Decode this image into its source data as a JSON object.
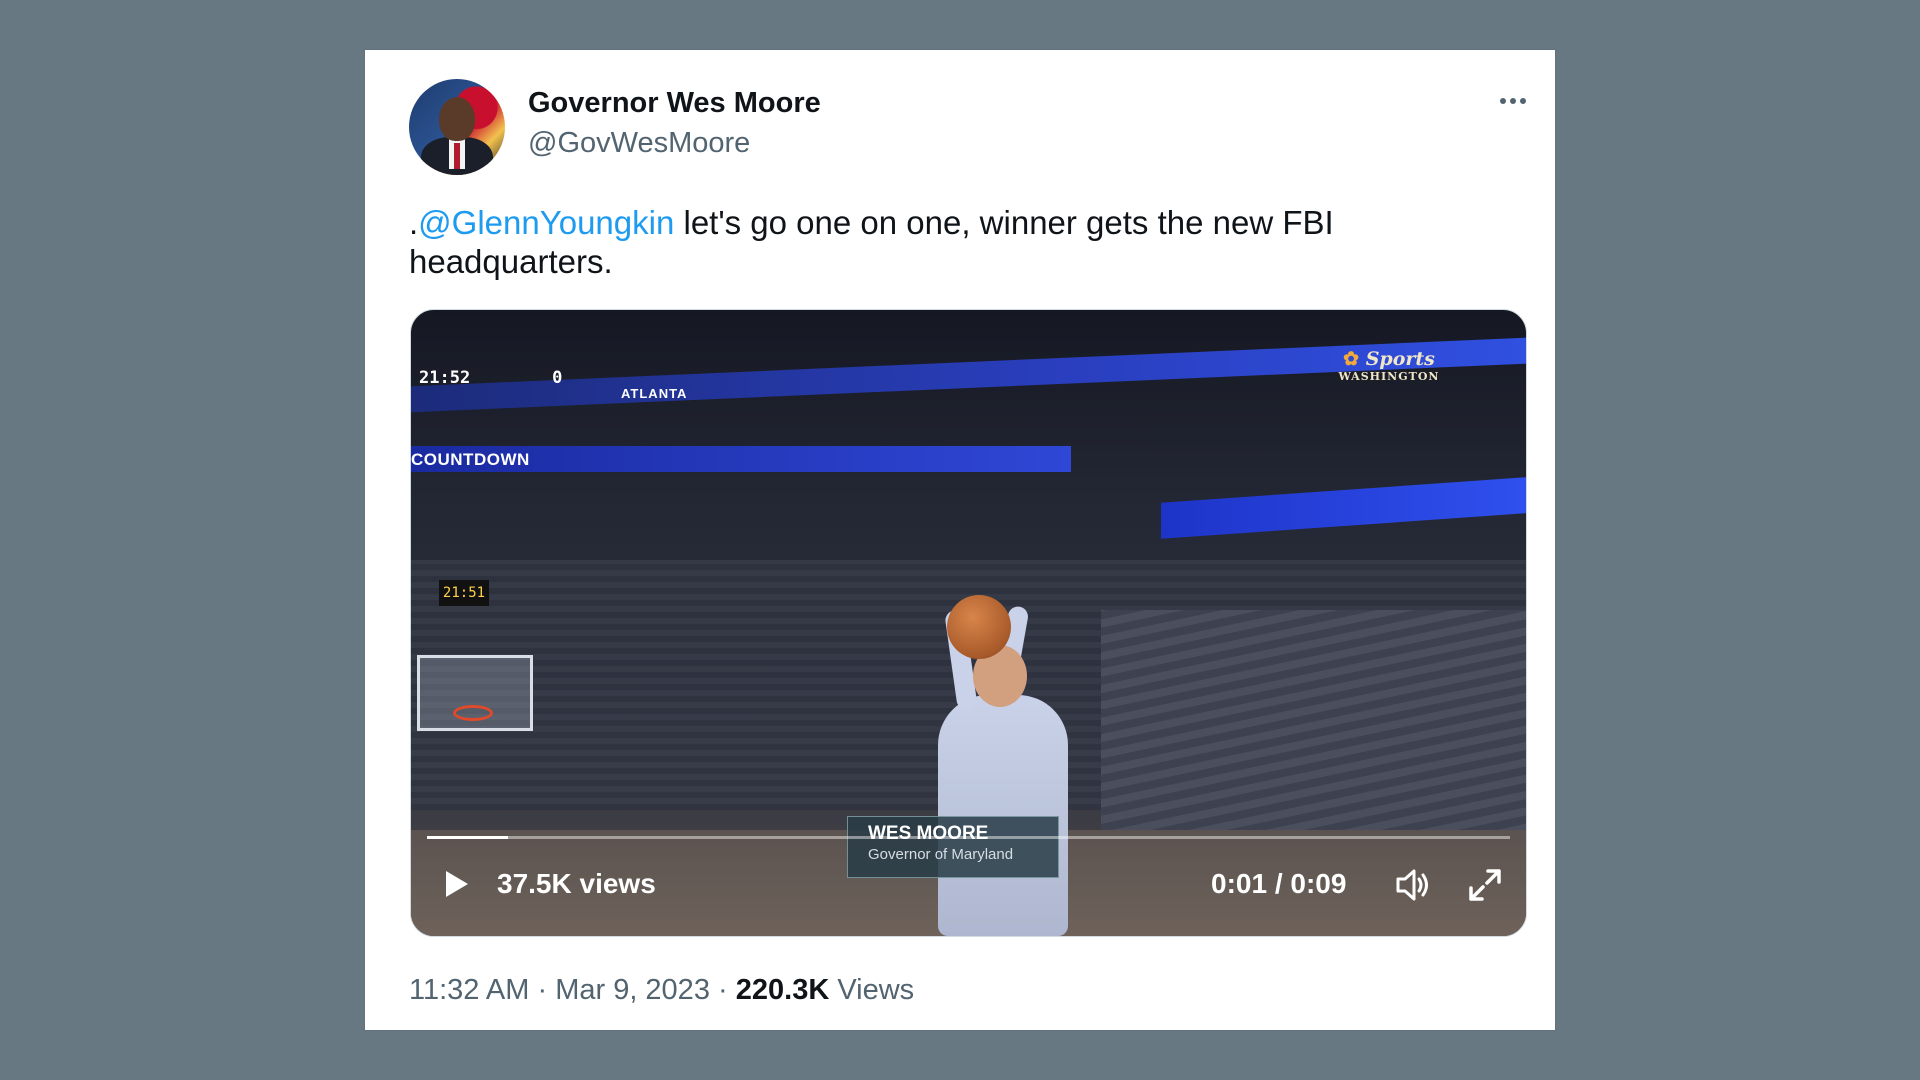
{
  "tweet": {
    "author_name": "Governor Wes Moore",
    "author_handle": "@GovWesMoore",
    "text_prefix": ".",
    "mention": "@GlennYoungkin",
    "text_body": " let's go one on one, winner gets the new FBI headquarters.",
    "more_icon": "more-horizontal-icon"
  },
  "video": {
    "scoreboard_time": "21:52",
    "scoreboard_score": "0",
    "scoreboard_team": "ATLANTA",
    "countdown_text": "COUNTDOWN",
    "shot_clock": "21:51",
    "network_logo_main": "Sports",
    "network_logo_sub": "WASHINGTON",
    "lower_third_name": "WES MOORE",
    "lower_third_title": "Governor of Maryland",
    "views_label": "37.5K views",
    "time_label": "0:01 / 0:09",
    "progress": 0.075,
    "play_icon": "play-icon",
    "volume_icon": "volume-icon",
    "fullscreen_icon": "fullscreen-icon"
  },
  "footer": {
    "time": "11:32 AM",
    "separator": "·",
    "date": "Mar 9, 2023",
    "views_count": "220.3K",
    "views_word": "Views"
  }
}
